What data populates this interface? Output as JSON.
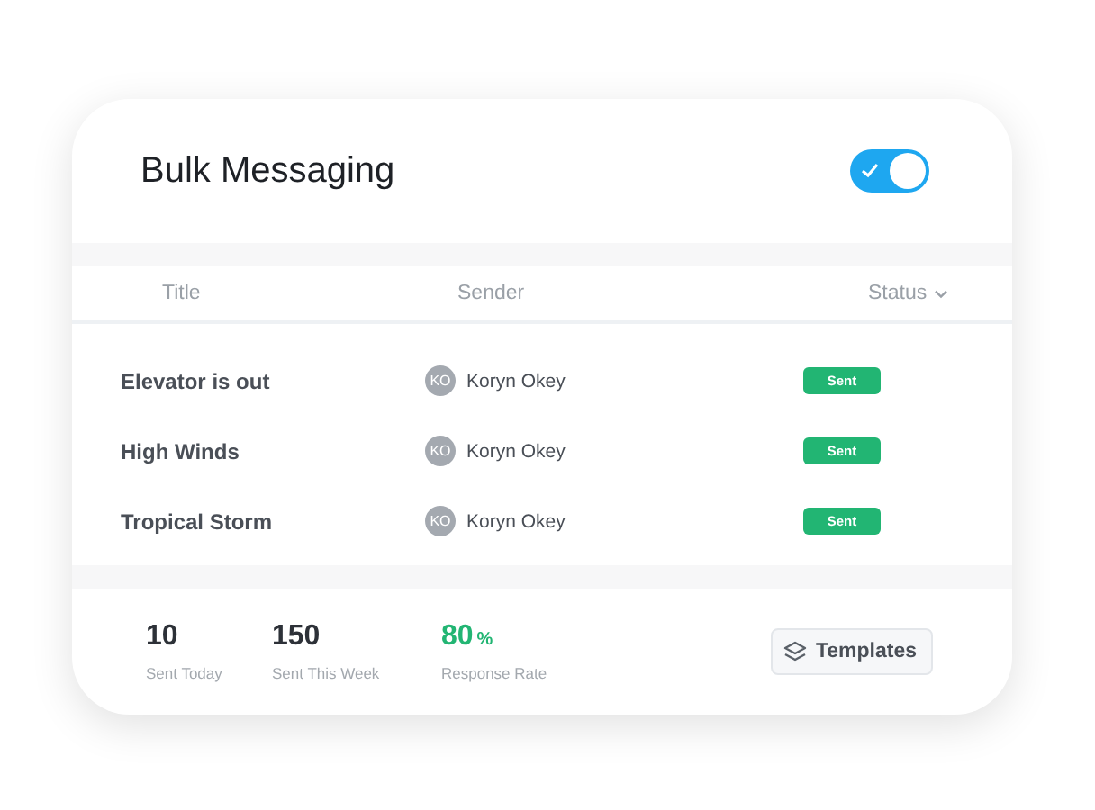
{
  "header": {
    "title": "Bulk Messaging",
    "toggle": {
      "on": true
    }
  },
  "table": {
    "columns": [
      {
        "label": "Title",
        "sortable": false
      },
      {
        "label": "Sender",
        "sortable": false
      },
      {
        "label": "Status",
        "sortable": true
      }
    ],
    "rows": [
      {
        "title": "Elevator is out",
        "sender_initials": "KO",
        "sender": "Koryn Okey",
        "status": "Sent"
      },
      {
        "title": "High Winds",
        "sender_initials": "KO",
        "sender": "Koryn Okey",
        "status": "Sent"
      },
      {
        "title": "Tropical Storm",
        "sender_initials": "KO",
        "sender": "Koryn Okey",
        "status": "Sent"
      }
    ]
  },
  "stats": [
    {
      "value": "10",
      "label": "Sent Today",
      "color": "#2d3138"
    },
    {
      "value": "150",
      "label": "Sent This Week",
      "color": "#2d3138"
    },
    {
      "value": "80",
      "unit": "%",
      "label": "Response Rate",
      "color": "#22b573"
    }
  ],
  "templates_button": {
    "label": "Templates"
  }
}
